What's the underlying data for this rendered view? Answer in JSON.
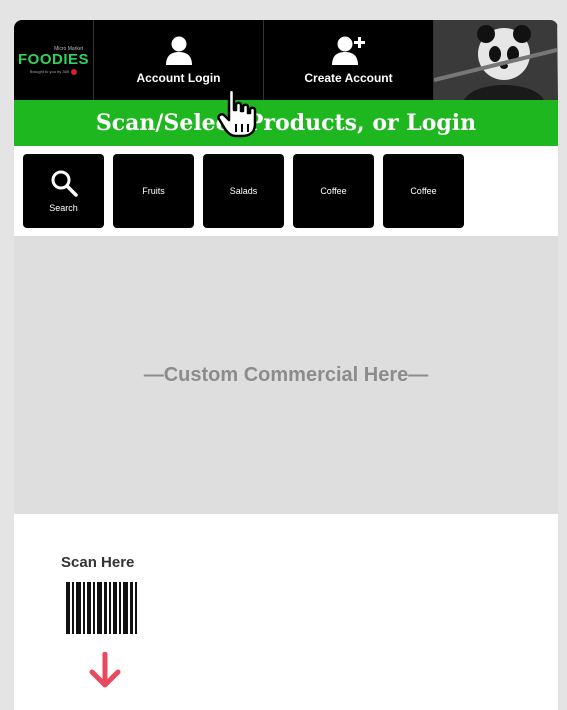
{
  "topbar": {
    "logo": {
      "tiny": "Micro Market",
      "brand": "FOODIES",
      "sub": "Brought to you by 365"
    },
    "account_login": {
      "label": "Account Login",
      "icon": "user-icon"
    },
    "create_account": {
      "label": "Create Account",
      "icon": "user-plus-icon"
    },
    "photo": {
      "icon": "panda-photo"
    }
  },
  "banner": {
    "text": "Scan/Select Products, or Login"
  },
  "categories": [
    {
      "label": "Search",
      "icon": "search-icon"
    },
    {
      "label": "Fruits"
    },
    {
      "label": "Salads"
    },
    {
      "label": "Coffee"
    },
    {
      "label": "Coffee"
    }
  ],
  "commercial": {
    "text": "—Custom Commercial Here—"
  },
  "scan": {
    "title": "Scan Here",
    "icon": "barcode-icon",
    "arrow_icon": "arrow-down-icon",
    "arrow_color": "#e8495c"
  },
  "colors": {
    "accent_green": "#1fb71f",
    "brand_green": "#2fd35b"
  }
}
